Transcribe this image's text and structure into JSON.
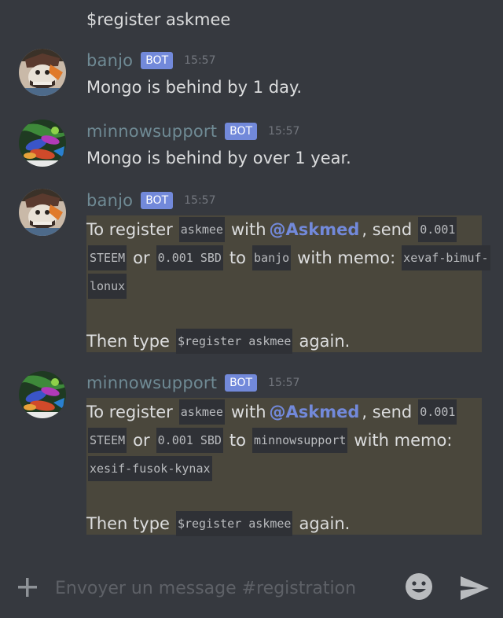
{
  "command_line": "$register askmee",
  "messages": [
    {
      "author": "banjo",
      "tag": "BOT",
      "time": "15:57",
      "text": "Mongo is behind by 1 day."
    },
    {
      "author": "minnowsupport",
      "tag": "BOT",
      "time": "15:57",
      "text": "Mongo is behind by over 1 year."
    },
    {
      "author": "banjo",
      "tag": "BOT",
      "time": "15:57",
      "embed": {
        "l1_a": "To register",
        "l1_code1": "askmee",
        "l1_b": "with",
        "l1_mention": "@Askmed",
        "l1_c": ", send",
        "l1_code2": "0.001",
        "l2_code1": "STEEM",
        "l2_a": "or",
        "l2_code2": "0.001 SBD",
        "l2_b": "to",
        "l2_code3": "banjo",
        "l2_c": "with memo:",
        "l2_code4": "xevaf-bimuf-",
        "l3_code1": "lonux",
        "l4_a": "Then type",
        "l4_code1": "$register askmee",
        "l4_b": "again."
      }
    },
    {
      "author": "minnowsupport",
      "tag": "BOT",
      "time": "15:57",
      "embed": {
        "l1_a": "To register",
        "l1_code1": "askmee",
        "l1_b": "with",
        "l1_mention": "@Askmed",
        "l1_c": ", send",
        "l1_code2": "0.001",
        "l2_code1": "STEEM",
        "l2_a": "or",
        "l2_code2": "0.001 SBD",
        "l2_b": "to",
        "l2_code3": "minnowsupport",
        "l2_c": "with memo:",
        "l3_code1": "xesif-fusok-kynax",
        "l4_a": "Then type",
        "l4_code1": "$register askmee",
        "l4_b": "again."
      }
    }
  ],
  "composer": {
    "placeholder": "Envoyer un message #registration"
  },
  "icons": {
    "add": "plus-icon",
    "emoji": "emoji-icon",
    "send": "send-icon"
  },
  "colors": {
    "background": "#36393f",
    "author": "#6f8a94",
    "bot_tag": "#7289da",
    "mention": "#7289da",
    "embed_bg": "#4a473c",
    "code_bg": "#2f3136"
  }
}
